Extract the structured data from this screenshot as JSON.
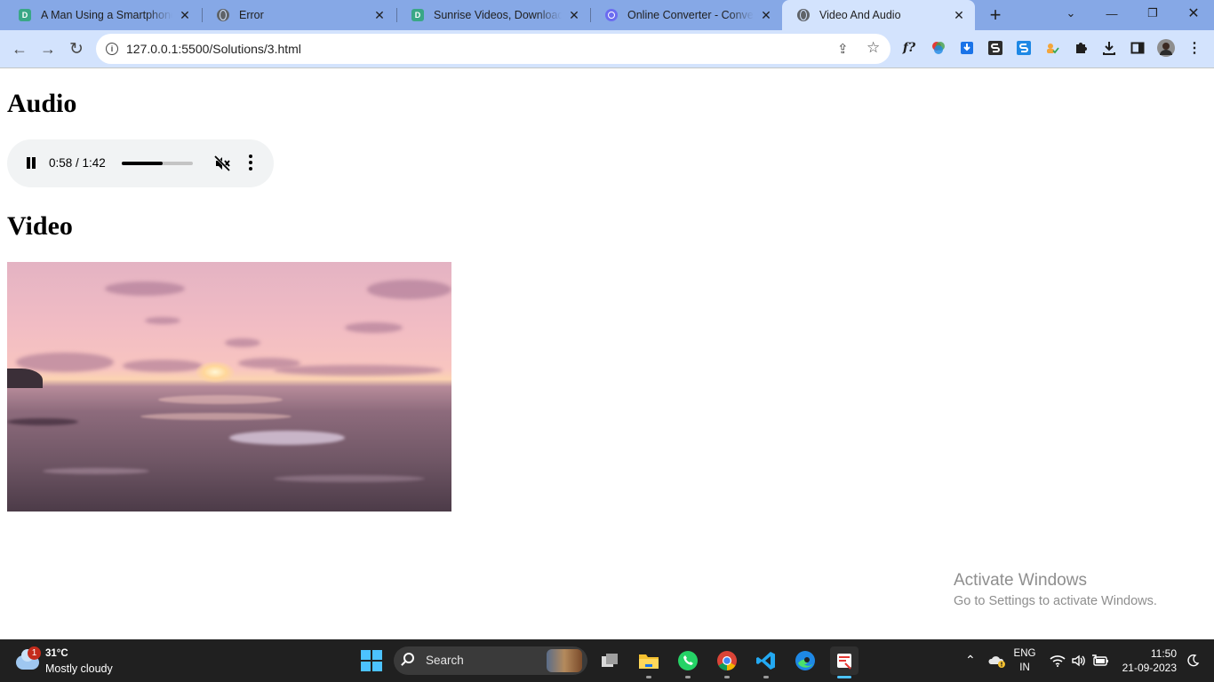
{
  "browser": {
    "tabs": [
      {
        "title": "A Man Using a Smartphone I",
        "favicon": "d-icon",
        "active": false
      },
      {
        "title": "Error",
        "favicon": "globe-icon",
        "active": false
      },
      {
        "title": "Sunrise Videos, Download Th",
        "favicon": "d-icon",
        "active": false
      },
      {
        "title": "Online Converter - Convert I",
        "favicon": "converter-icon",
        "active": false
      },
      {
        "title": "Video And Audio",
        "favicon": "globe-icon",
        "active": true
      }
    ],
    "favicon_letter": "D",
    "new_tab_symbol": "+",
    "url": "127.0.0.1:5500/Solutions/3.html",
    "accent_color": "#86a8e6",
    "toolbar_color": "#d3e3fd"
  },
  "page": {
    "audio_heading": "Audio",
    "video_heading": "Video",
    "audio_player": {
      "state": "playing",
      "time_display": "0:58 / 1:42",
      "volume_fraction": 0.55,
      "muted": true
    },
    "video": {
      "description_icon": "sunset-video-frame"
    }
  },
  "watermark": {
    "title": "Activate Windows",
    "subtitle": "Go to Settings to activate Windows."
  },
  "taskbar": {
    "weather": {
      "badge": "1",
      "temperature": "31°C",
      "condition": "Mostly cloudy"
    },
    "search_label": "Search",
    "language": {
      "line1": "ENG",
      "line2": "IN"
    },
    "clock": {
      "time": "11:50",
      "date": "21-09-2023"
    }
  }
}
